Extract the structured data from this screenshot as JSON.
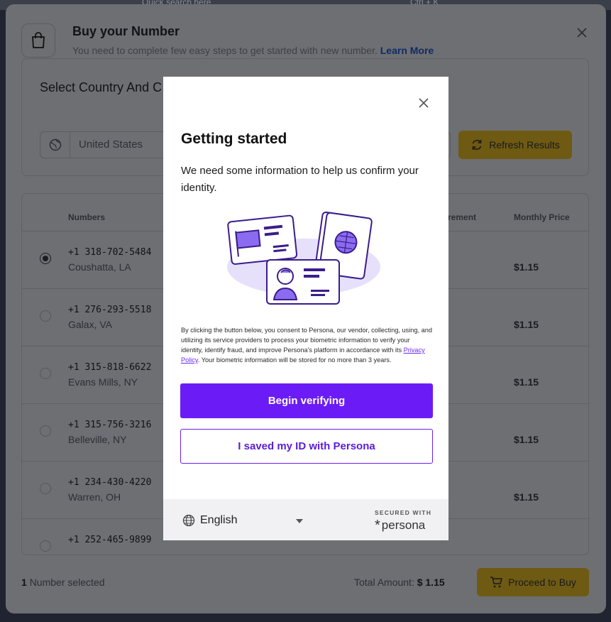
{
  "background": {
    "search_placeholder": "Quick search here",
    "shortcut": "Ctrl + K"
  },
  "dialog": {
    "title": "Buy your Number",
    "subtitle": "You need to complete few easy steps to get started with new number.",
    "learn_more": "Learn More",
    "icons": {
      "header": "shopping-bag-icon",
      "close": "close-icon"
    }
  },
  "filters": {
    "title": "Select Country And C",
    "country": "United States",
    "refresh_label": "Refresh Results"
  },
  "table": {
    "headers": {
      "numbers": "Numbers",
      "requirement": "rement",
      "monthly_price": "Monthly Price"
    },
    "rows": [
      {
        "number": "+1 318-702-5484",
        "location": "Coushatta, LA",
        "price": "$1.15",
        "selected": true
      },
      {
        "number": "+1 276-293-5518",
        "location": "Galax, VA",
        "price": "$1.15",
        "selected": false
      },
      {
        "number": "+1 315-818-6622",
        "location": "Evans Mills, NY",
        "price": "$1.15",
        "selected": false
      },
      {
        "number": "+1 315-756-3216",
        "location": "Belleville, NY",
        "price": "$1.15",
        "selected": false
      },
      {
        "number": "+1 234-430-4220",
        "location": "Warren, OH",
        "price": "$1.15",
        "selected": false
      },
      {
        "number": "+1 252-465-9899",
        "location": "",
        "price": "",
        "selected": false
      }
    ]
  },
  "footer": {
    "selected_count": "1",
    "selected_text": "Number selected",
    "total_label": "Total Amount:",
    "total_value": "$ 1.15",
    "proceed_label": "Proceed to Buy"
  },
  "persona": {
    "title": "Getting started",
    "description": "We need some information to help us confirm your identity.",
    "legal_before": "By clicking the button below, you consent to Persona, our vendor, collecting, using, and utilizing its service providers to process your biometric information to verify your identity, identify fraud, and improve Persona's platform in accordance with its ",
    "legal_link": "Privacy Policy",
    "legal_after": ". Your biometric information will be stored for no more than 3 years.",
    "begin_label": "Begin verifying",
    "saved_label": "I saved my ID with Persona",
    "language": "English",
    "secured_with": "SECURED WITH",
    "brand": "persona",
    "accent_color": "#6b1cf6"
  }
}
